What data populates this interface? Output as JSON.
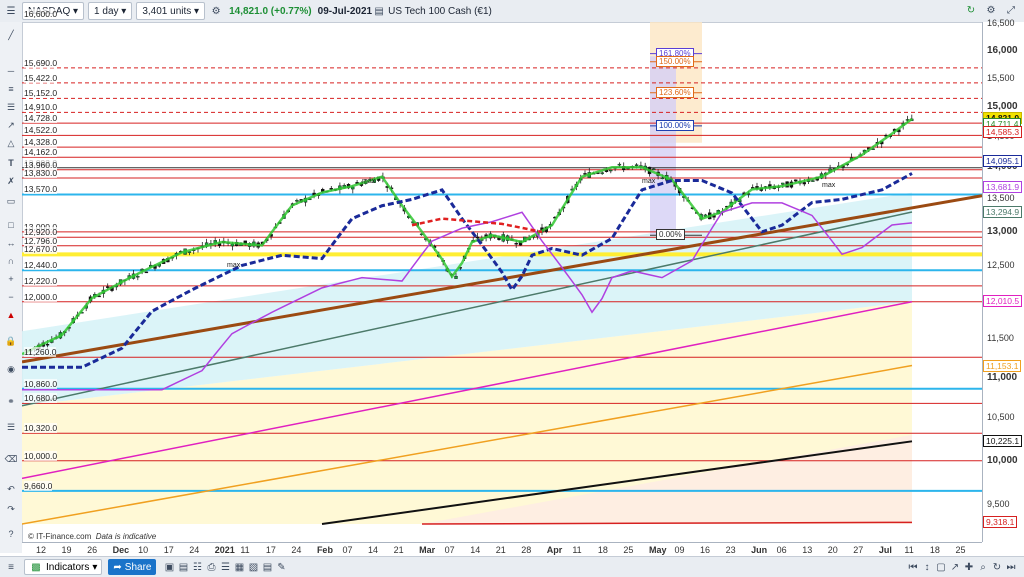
{
  "header": {
    "instrument": "NASDAQ",
    "timeframe": "1 day",
    "units": "3,401 units",
    "price": "14,821.0 (+0.77%)",
    "date": "09-Jul-2021",
    "name": "US Tech 100 Cash (€1)"
  },
  "footer": {
    "indicators_label": "Indicators",
    "share_label": "Share",
    "copyright": "© IT-Finance.com",
    "disclaimer": "Data is indicative"
  },
  "colors": {
    "resistance": "#d62020",
    "support_blue": "#1f5fd0",
    "light_blue": "#2cb5ec",
    "yellow_band": "#ffee33",
    "brown_trend": "#9b4a12",
    "magenta": "#e020c0",
    "orange": "#f0a020",
    "navy_ma": "#1a2a99",
    "purple_ma": "#b040e0",
    "green_ma": "#32c832",
    "gray_ma": "#4c7a6a"
  },
  "price_axis": {
    "ticks": [
      "16,500",
      "16,000",
      "15,500",
      "15,000",
      "14,500",
      "14,000",
      "13,500",
      "13,000",
      "12,500",
      "12,000",
      "11,500",
      "11,000",
      "10,500",
      "10,000",
      "9,500"
    ],
    "current_tag": "14,821.0",
    "tags": [
      "14,711.4",
      "14,585.3",
      "14,095.1",
      "13,681.9",
      "13,294.9",
      "12,010.5",
      "11,153.1",
      "10,225.1",
      "9,318.1"
    ]
  },
  "level_labels": [
    "16,600.0",
    "15,690.0",
    "15,422.0",
    "15,152.0",
    "14,910.0",
    "14,728.0",
    "14,522.0",
    "14,328.0",
    "14,162.0",
    "13,992.0",
    "13,960.0",
    "13,830.0",
    "13,570.0",
    "13,000.0",
    "12,920.0",
    "12,796.0",
    "12,670.0",
    "12,440.0",
    "12,220.0",
    "12,000.0",
    "11,260.0",
    "10,860.0",
    "10,680.0",
    "10,320.0",
    "10,000.0",
    "9,660.0"
  ],
  "fib": {
    "levels": [
      "161.80%",
      "150.00%",
      "123.60%",
      "100.00%",
      "0.00%"
    ]
  },
  "annotations": {
    "max": "max"
  },
  "time_axis": {
    "labels": [
      "12",
      "19",
      "26",
      "Dec",
      "10",
      "17",
      "24",
      "2021",
      "11",
      "17",
      "24",
      "Feb",
      "07",
      "14",
      "21",
      "Mar",
      "07",
      "14",
      "21",
      "28",
      "Apr",
      "11",
      "18",
      "25",
      "May",
      "09",
      "16",
      "23",
      "Jun",
      "06",
      "13",
      "20",
      "27",
      "Jul",
      "11",
      "18",
      "25"
    ]
  }
}
